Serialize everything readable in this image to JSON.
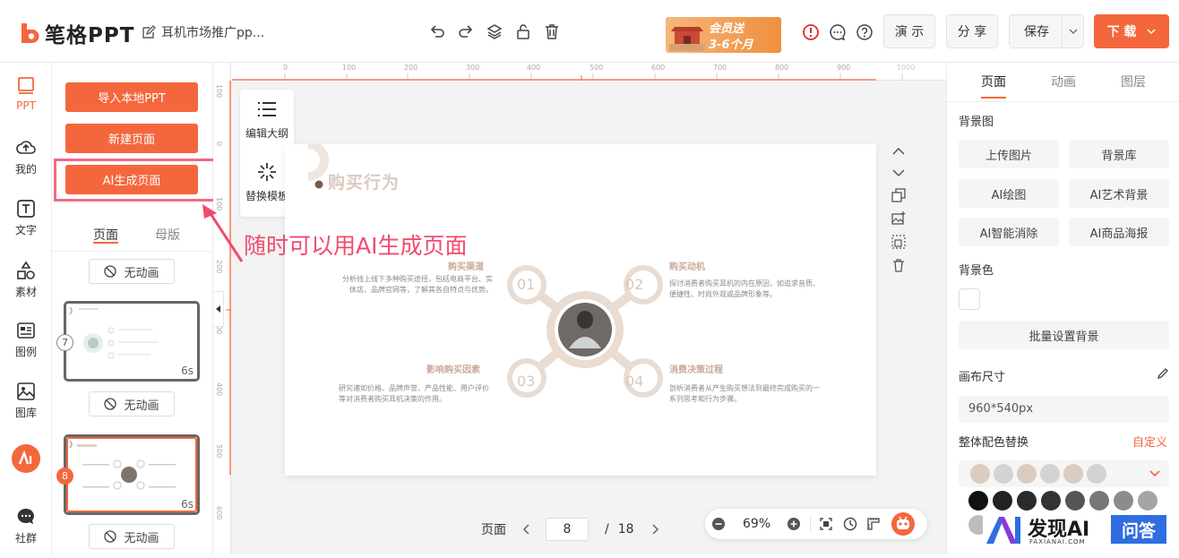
{
  "brand": {
    "name": "笔格PPT"
  },
  "doc": {
    "title": "耳机市场推广pp..."
  },
  "promo": {
    "line1": "会员送",
    "line2": "3-6个月"
  },
  "header_buttons": {
    "present": "演 示",
    "share": "分 享",
    "save": "保存",
    "download": "下 载"
  },
  "left_nav": [
    {
      "label": "PPT"
    },
    {
      "label": "我的"
    },
    {
      "label": "文字"
    },
    {
      "label": "素材"
    },
    {
      "label": "图例"
    },
    {
      "label": "图库"
    },
    {
      "label": "社群"
    }
  ],
  "panel": {
    "import": "导入本地PPT",
    "new_page": "新建页面",
    "ai_page": "AI生成页面",
    "tab_pages": "页面",
    "tab_master": "母版",
    "no_anim": "无动画",
    "thumbs": [
      {
        "num": "7",
        "duration": "6s"
      },
      {
        "num": "8",
        "duration": "6s"
      }
    ]
  },
  "float": {
    "outline": "编辑大纲",
    "template": "替换模板"
  },
  "annotation": "随时可以用AI生成页面",
  "ruler": {
    "top": [
      "0",
      "100",
      "200",
      "300",
      "400",
      "500",
      "600",
      "700",
      "800",
      "900",
      "1000"
    ],
    "left": [
      "100",
      "0",
      "100",
      "200",
      "300",
      "400",
      "500",
      "600"
    ]
  },
  "slide": {
    "title": "购买行为",
    "nodes": [
      "01",
      "02",
      "03",
      "04"
    ],
    "sections": [
      {
        "heading": "购买渠道",
        "text": "分析线上线下多种购买途径，包括电商平台、实体店、品牌官网等，了解其各自特点与优势。"
      },
      {
        "heading": "购买动机",
        "text": "探讨消费者购买耳机的内在原因，如追求音质、便捷性、时尚外观或品牌形象等。"
      },
      {
        "heading": "影响购买因素",
        "text": "研究诸如价格、品牌声誉、产品性能、用户评价等对消费者购买耳机决策的作用。"
      },
      {
        "heading": "消费决策过程",
        "text": "剖析消费者从产生购买想法到最终完成购买的一系列思考和行为步骤。"
      }
    ]
  },
  "pager": {
    "label": "页面",
    "current": "8",
    "total": "18",
    "sep": "/"
  },
  "zoom": {
    "value": "69%"
  },
  "right": {
    "tabs": [
      "页面",
      "动画",
      "图层"
    ],
    "bg_image_label": "背景图",
    "bg_buttons": [
      "上传图片",
      "背景库",
      "AI绘图",
      "AI艺术背景",
      "AI智能消除",
      "AI商品海报"
    ],
    "bg_color_label": "背景色",
    "batch_bg": "批量设置背景",
    "canvas_size_label": "画布尺寸",
    "canvas_size": "960*540px",
    "color_replace_label": "整体配色替换",
    "custom": "自定义",
    "palette_top": [
      "#dcccbf",
      "#d3d3d3",
      "#dcccbf",
      "#d3d3d3",
      "#dcccbf",
      "#d3d3d3"
    ],
    "palette_row": [
      "#111111",
      "#222222",
      "#2a2a2a",
      "#333333",
      "#555555",
      "#777777",
      "#8c8c8c",
      "#a5a5a5"
    ]
  },
  "watermark": {
    "brand": "发现AI",
    "sub": "FAXIANAI.COM",
    "tag": "问答"
  },
  "colors": {
    "accent": "#f4673d",
    "annotation": "#f04b6e"
  }
}
